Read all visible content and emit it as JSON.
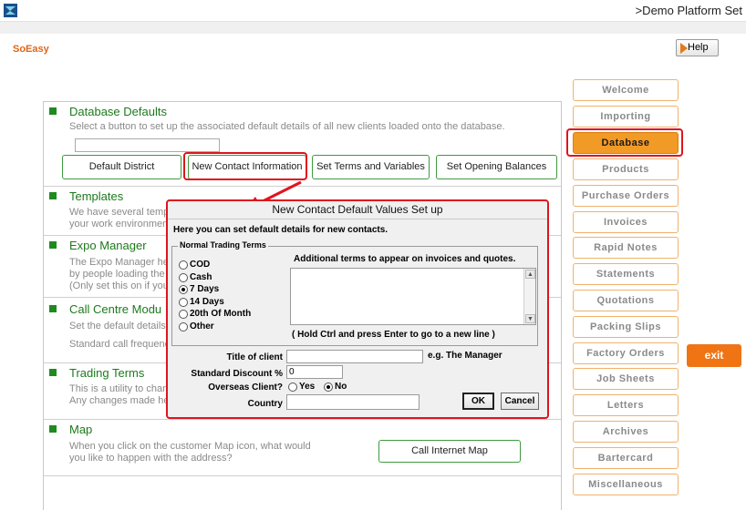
{
  "window": {
    "title": ">Demo Platform Set"
  },
  "brand": {
    "name": "SoEasy"
  },
  "help": {
    "label": "Help"
  },
  "sections": {
    "database_defaults": {
      "title": "Database Defaults",
      "description": "Select a button to set up the associated default details of all new clients loaded onto the database.",
      "buttons": {
        "default_district": "Default District",
        "new_contact_information": "New Contact Information",
        "set_terms_and_variables": "Set Terms and Variables",
        "set_opening_balances": "Set Opening Balances"
      }
    },
    "templates": {
      "title": "Templates",
      "line1": "We have several temp",
      "line2": "your work environment"
    },
    "expo_manager": {
      "title": "Expo Manager",
      "line1": "The Expo Manager he",
      "line2": "by people loading the",
      "line3": "(Only set this on if you"
    },
    "call_centre": {
      "title": "Call Centre Modu",
      "line1": "Set the default details f",
      "line2": "Standard call frequenc"
    },
    "trading_terms": {
      "title": "Trading Terms",
      "line1": "This is a utility to chang",
      "line2": "Any changes made he"
    },
    "map": {
      "title": "Map",
      "line1": "When you click on the customer Map icon, what would",
      "line2": "you like to happen with the address?",
      "button": "Call Internet Map"
    }
  },
  "nav": {
    "items": [
      {
        "label": "Welcome",
        "active": false
      },
      {
        "label": "Importing",
        "active": false
      },
      {
        "label": "Database",
        "active": true
      },
      {
        "label": "Products",
        "active": false
      },
      {
        "label": "Purchase Orders",
        "active": false
      },
      {
        "label": "Invoices",
        "active": false
      },
      {
        "label": "Rapid Notes",
        "active": false
      },
      {
        "label": "Statements",
        "active": false
      },
      {
        "label": "Quotations",
        "active": false
      },
      {
        "label": "Packing Slips",
        "active": false
      },
      {
        "label": "Factory Orders",
        "active": false
      },
      {
        "label": "Job Sheets",
        "active": false
      },
      {
        "label": "Letters",
        "active": false
      },
      {
        "label": "Archives",
        "active": false
      },
      {
        "label": "Bartercard",
        "active": false
      },
      {
        "label": "Miscellaneous",
        "active": false
      }
    ],
    "exit_label": "exit"
  },
  "dialog": {
    "title": "New Contact Default Values Set up",
    "intro": "Here you can set default details for new contacts.",
    "group_label": "Normal Trading Terms",
    "terms_options": [
      {
        "label": "COD",
        "selected": false
      },
      {
        "label": "Cash",
        "selected": false
      },
      {
        "label": "7 Days",
        "selected": true
      },
      {
        "label": "14 Days",
        "selected": false
      },
      {
        "label": "20th Of Month",
        "selected": false
      },
      {
        "label": "Other",
        "selected": false
      }
    ],
    "additional_terms_label": "Additional terms to appear on invoices and quotes.",
    "additional_terms_value": "",
    "additional_terms_hint": "( Hold Ctrl and press Enter to go to a new line )",
    "title_of_client_label": "Title of client",
    "title_of_client_value": "",
    "title_example": "e.g. The Manager",
    "standard_discount_label": "Standard Discount %",
    "standard_discount_value": "0",
    "overseas_label": "Overseas Client?",
    "overseas_options": [
      {
        "label": "Yes",
        "selected": false
      },
      {
        "label": "No",
        "selected": true
      }
    ],
    "country_label": "Country",
    "country_value": "",
    "ok_label": "OK",
    "cancel_label": "Cancel"
  },
  "colors": {
    "brand_orange": "#e0651a",
    "nav_border": "#f0b26b",
    "nav_active": "#f29a26",
    "exit": "#f07414",
    "section_green": "#1c7a1c",
    "highlight_red": "#e0141e"
  }
}
